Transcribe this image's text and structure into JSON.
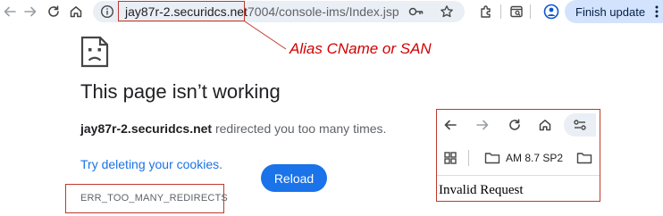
{
  "browser": {
    "url_host": "jay87r-2.securidcs.net",
    "url_path": "7004/console-ims/Index.jsp",
    "update_button_label": "Finish update",
    "icons": [
      "back-icon",
      "forward-icon",
      "reload-icon",
      "home-icon",
      "info-icon",
      "key-icon",
      "star-icon",
      "extensions-icon",
      "tab-search-icon",
      "profile-icon",
      "more-icon"
    ]
  },
  "annotation": {
    "label": "Alias CName or SAN",
    "color": "#d20000"
  },
  "error_page": {
    "title": "This page isn’t working",
    "host": "jay87r-2.securidcs.net",
    "message_suffix": " redirected you too many times.",
    "try_link": "Try deleting your cookies",
    "try_suffix": ".",
    "reload_label": "Reload",
    "error_code": "ERR_TOO_MANY_REDIRECTS"
  },
  "inset": {
    "bookmark_label": "AM 8.7 SP2",
    "body_text": "Invalid Request"
  },
  "colors": {
    "accent": "#1a73e8",
    "highlight_box": "#c0392b",
    "update_button_bg": "#d3e3fd"
  }
}
